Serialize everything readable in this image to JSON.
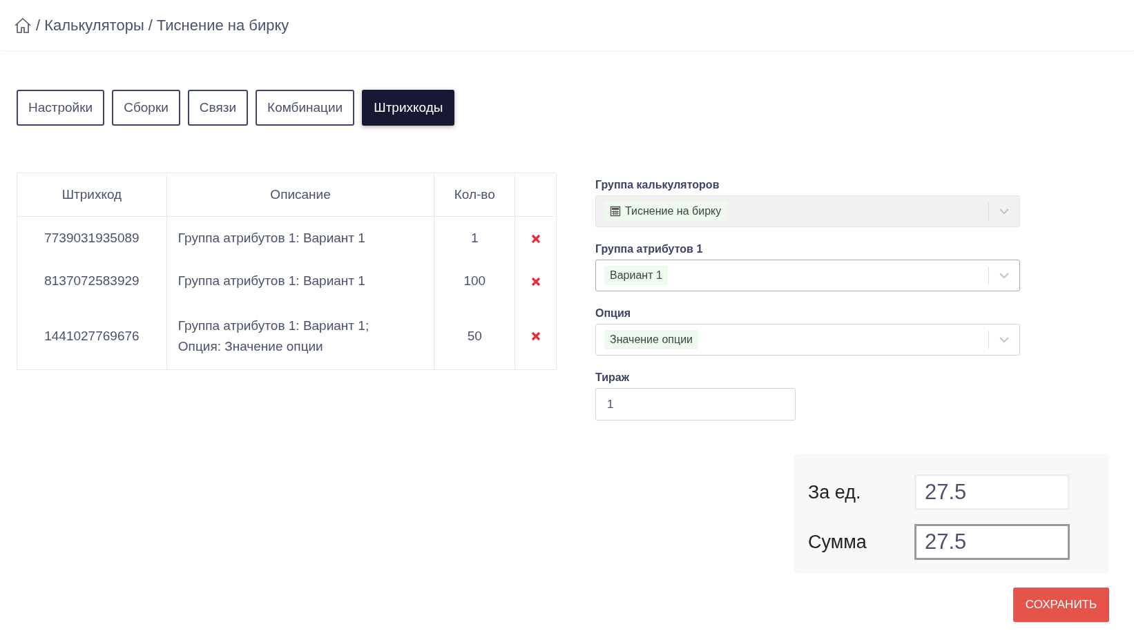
{
  "breadcrumb": {
    "separator": "/",
    "items": [
      "Калькуляторы",
      "Тиснение на бирку"
    ]
  },
  "tabs": [
    {
      "label": "Настройки",
      "selected": false
    },
    {
      "label": "Сборки",
      "selected": false
    },
    {
      "label": "Связи",
      "selected": false
    },
    {
      "label": "Комбинации",
      "selected": false
    },
    {
      "label": "Штрихкоды",
      "selected": true
    }
  ],
  "table": {
    "columns": [
      "Штрихкод",
      "Описание",
      "Кол-во"
    ],
    "rows": [
      {
        "barcode": "7739031935089",
        "description": "Группа атрибутов 1: Вариант 1",
        "quantity": "1"
      },
      {
        "barcode": "8137072583929",
        "description": "Группа атрибутов 1: Вариант 1",
        "quantity": "100"
      },
      {
        "barcode": "1441027769676",
        "description": "Группа атрибутов 1: Вариант 1;\nОпция: Значение опции",
        "quantity": "50"
      }
    ]
  },
  "form": {
    "selects": [
      {
        "label": "Группа калькуляторов",
        "value": "Тиснение на бирку",
        "disabled": true,
        "focused": false,
        "kind": "icon"
      },
      {
        "label": "Группа атрибутов 1",
        "value": "Вариант 1",
        "disabled": false,
        "focused": true,
        "kind": "plain"
      },
      {
        "label": "Опция",
        "value": "Значение опции",
        "disabled": false,
        "focused": false,
        "kind": "plain"
      }
    ],
    "quantity": {
      "label": "Тираж",
      "value": "1"
    }
  },
  "totals": [
    {
      "label": "За ед.",
      "value": "27.5",
      "focused": false
    },
    {
      "label": "Сумма",
      "value": "27.5",
      "focused": true
    }
  ],
  "save_button": "СОХРАНИТЬ"
}
